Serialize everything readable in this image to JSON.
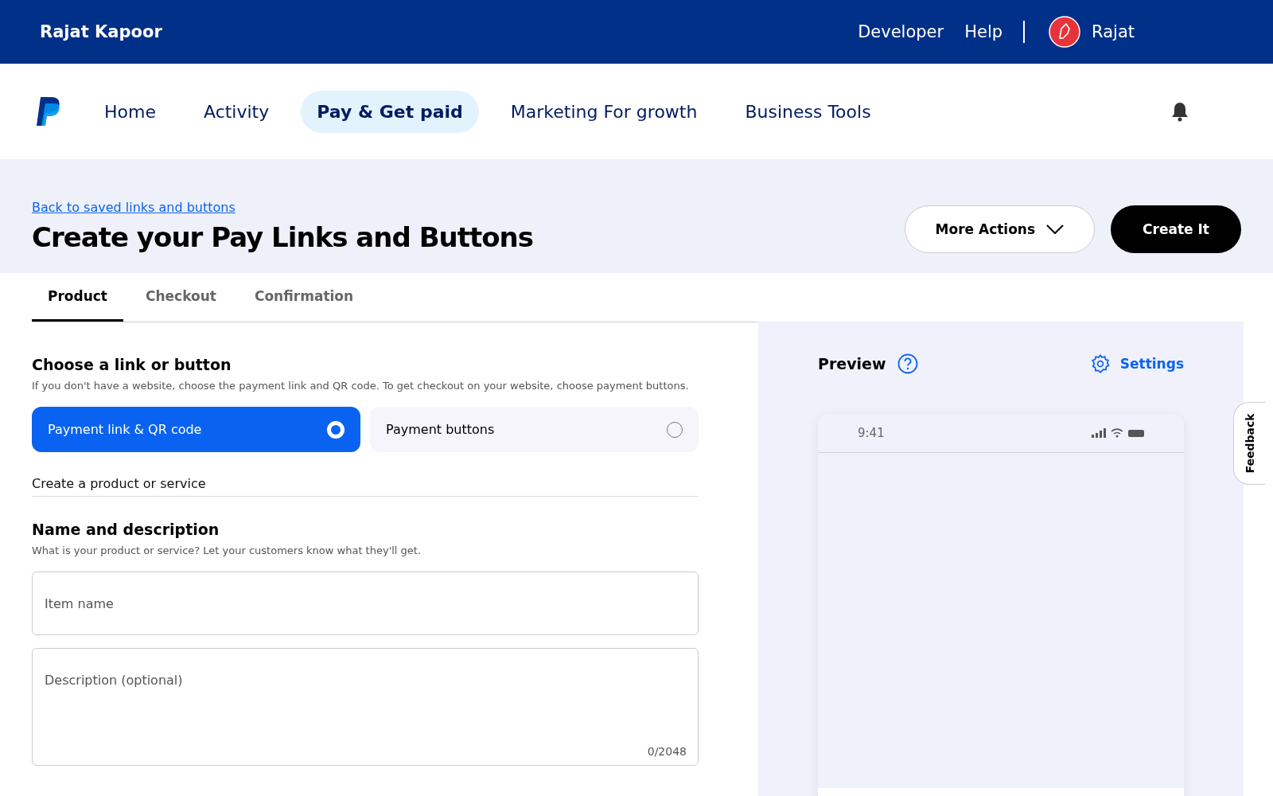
{
  "top_bar": {
    "account_name": "Rajat Kapoor",
    "links": [
      "Developer",
      "Help"
    ],
    "user_name": "Rajat"
  },
  "nav": {
    "items": [
      {
        "label": "Home",
        "selected": false
      },
      {
        "label": "Activity",
        "selected": false
      },
      {
        "label": "Pay & Get paid",
        "selected": true
      },
      {
        "label": "Marketing For growth",
        "selected": false
      },
      {
        "label": "Business Tools",
        "selected": false
      }
    ]
  },
  "header": {
    "back_link": "Back to saved links and buttons",
    "title": "Create your Pay Links and Buttons",
    "more_actions": "More Actions",
    "create_button": "Create It"
  },
  "tabs": [
    {
      "label": "Product",
      "selected": true
    },
    {
      "label": "Checkout",
      "selected": false
    },
    {
      "label": "Confirmation",
      "selected": false
    }
  ],
  "choose": {
    "heading": "Choose a link or button",
    "description": "If you don't have a website, choose the payment link and QR code. To get checkout on your website, choose payment buttons.",
    "options": [
      {
        "label": "Payment link & QR code",
        "selected": true
      },
      {
        "label": "Payment buttons",
        "selected": false
      }
    ]
  },
  "product_label": "Create a product or service",
  "name_section": {
    "heading": "Name and description",
    "description": "What is your product or service? Let your customers know what they'll get.",
    "item_name": {
      "placeholder": "Item name"
    },
    "description_field": {
      "placeholder": "Description (optional)",
      "counter": "0/2048"
    }
  },
  "preview": {
    "title": "Preview",
    "settings": "Settings",
    "phone_time": "9:41"
  },
  "feedback": "Feedback"
}
